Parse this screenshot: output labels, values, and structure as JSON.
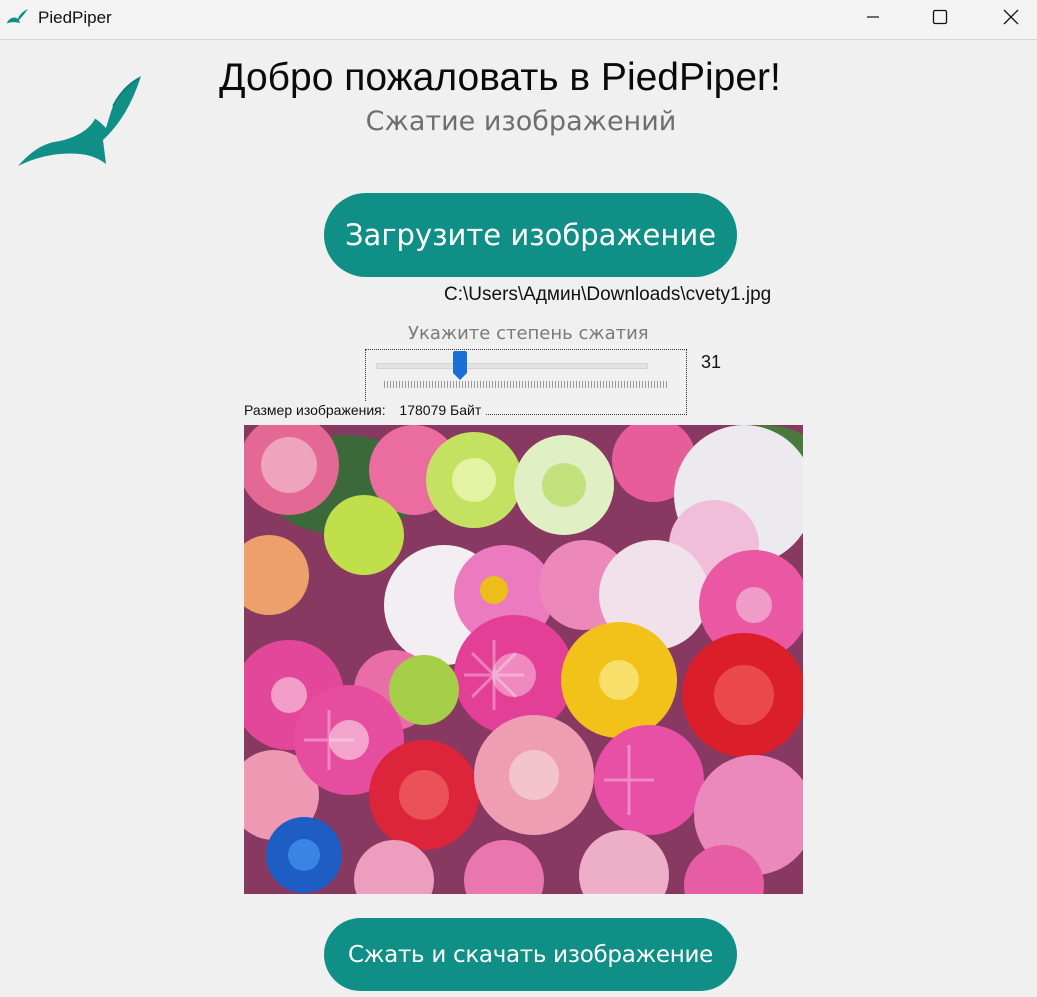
{
  "window": {
    "title": "PiedPiper",
    "icon": "feather-icon",
    "controls": [
      "minimize-icon",
      "maximize-icon",
      "close-icon"
    ]
  },
  "header": {
    "welcome": "Добро пожаловать в PiedPiper!",
    "subtitle": "Сжатие изображений",
    "logo": "feather-logo"
  },
  "upload": {
    "button_label": "Загрузите изображение",
    "file_path": "C:\\Users\\Админ\\Downloads\\cvety1.jpg"
  },
  "compression": {
    "label": "Укажите степень сжатия",
    "value": 31,
    "value_text": "31",
    "min": 0,
    "max": 100
  },
  "image_info": {
    "size_label": "Размер изображения:",
    "size_value": "178079 Байт"
  },
  "preview": {
    "content": "flower bouquet photo"
  },
  "actions": {
    "download_label": "Сжать и скачать изображение"
  },
  "colors": {
    "accent": "#0f8f86",
    "slider_thumb": "#1a6ed8",
    "background": "#f0f0f0"
  }
}
